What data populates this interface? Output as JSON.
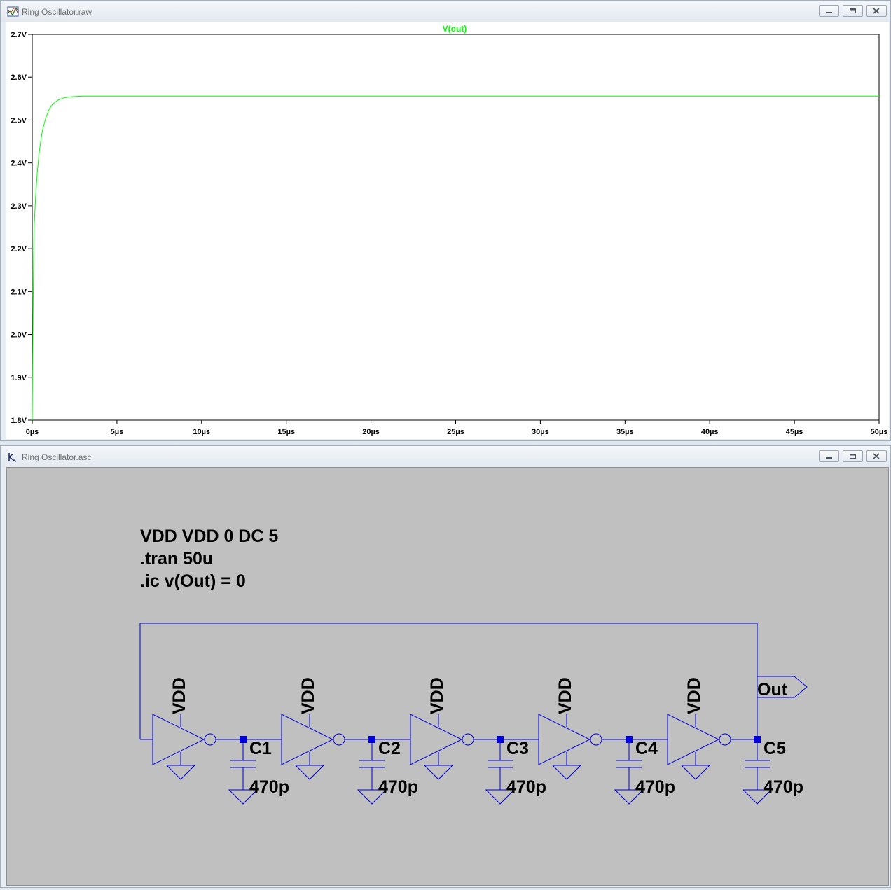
{
  "plot_window": {
    "title": "Ring Oscillator.raw",
    "icon": "waveform-icon",
    "trace_label": "V(out)",
    "trace_color": "#00ff00",
    "axis_color": "#000000",
    "y_ticks": [
      "2.7V",
      "2.6V",
      "2.5V",
      "2.4V",
      "2.3V",
      "2.2V",
      "2.1V",
      "2.0V",
      "1.9V",
      "1.8V"
    ],
    "x_ticks": [
      "0µs",
      "5µs",
      "10µs",
      "15µs",
      "20µs",
      "25µs",
      "30µs",
      "35µs",
      "40µs",
      "45µs",
      "50µs"
    ]
  },
  "chart_data": {
    "type": "line",
    "title": "V(out)",
    "xlabel": "",
    "ylabel": "",
    "xlim": [
      0,
      50
    ],
    "ylim": [
      1.8,
      2.7
    ],
    "x_unit": "µs",
    "y_unit": "V",
    "grid": false,
    "series": [
      {
        "name": "V(out)",
        "color": "#00ff00",
        "x": [
          0,
          0.05,
          0.1,
          0.2,
          0.3,
          0.4,
          0.5,
          0.6,
          0.8,
          1.0,
          1.2,
          1.5,
          1.8,
          2.2,
          2.6,
          3.0,
          4.0,
          5.0,
          10,
          20,
          30,
          40,
          50
        ],
        "y": [
          1.8,
          2.05,
          2.24,
          2.32,
          2.38,
          2.42,
          2.45,
          2.475,
          2.505,
          2.525,
          2.537,
          2.546,
          2.551,
          2.554,
          2.555,
          2.556,
          2.556,
          2.556,
          2.556,
          2.556,
          2.556,
          2.556,
          2.556
        ]
      }
    ]
  },
  "schematic_window": {
    "title": "Ring Oscillator.asc",
    "icon": "schematic-icon",
    "wire_color": "#0000d8",
    "directives": [
      "VDD VDD 0 DC 5",
      ".tran 50u",
      ".ic v(Out) = 0"
    ],
    "supply_label": "VDD",
    "output_label": "Out",
    "capacitors": [
      {
        "name": "C1",
        "value": "470p"
      },
      {
        "name": "C2",
        "value": "470p"
      },
      {
        "name": "C3",
        "value": "470p"
      },
      {
        "name": "C4",
        "value": "470p"
      },
      {
        "name": "C5",
        "value": "470p"
      }
    ]
  }
}
